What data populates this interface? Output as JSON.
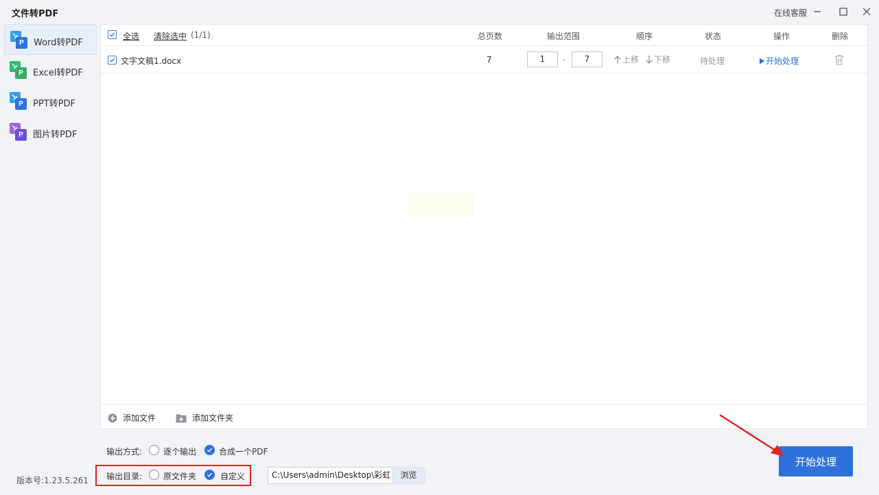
{
  "window": {
    "title": "文件转PDF",
    "service": "在线客服"
  },
  "sidebar": {
    "items": [
      {
        "label": "Word转PDF",
        "icon": "word-icon",
        "color": "#2e72d9",
        "back": "#35a0e8"
      },
      {
        "label": "Excel转PDF",
        "icon": "excel-icon",
        "color": "#3aab6a",
        "back": "#2fbe78"
      },
      {
        "label": "PPT转PDF",
        "icon": "ppt-icon",
        "color": "#2e72d9",
        "back": "#35a0e8"
      },
      {
        "label": "图片转PDF",
        "icon": "image-icon",
        "color": "#6b4fd8",
        "back": "#9a6ae0"
      }
    ]
  },
  "table": {
    "select_all": "全选",
    "clear_selection": "清除选中",
    "count": "(1/1)",
    "columns": {
      "pages": "总页数",
      "range": "输出范围",
      "order": "顺序",
      "status": "状态",
      "action": "操作",
      "delete": "删除"
    },
    "rows": [
      {
        "name": "文字文稿1.docx",
        "pages": "7",
        "range_from": "1",
        "range_sep": "-",
        "range_to": "7",
        "up": "上移",
        "down": "下移",
        "status": "待处理",
        "action": "开始处理"
      }
    ]
  },
  "footer": {
    "add_file": "添加文件",
    "add_folder": "添加文件夹"
  },
  "output": {
    "mode_label": "输出方式:",
    "mode_options": [
      "逐个输出",
      "合成一个PDF"
    ],
    "mode_selected": "合成一个PDF",
    "dir_label": "输出目录:",
    "dir_options": [
      "原文件夹",
      "自定义"
    ],
    "dir_selected": "自定义",
    "path": "C:\\Users\\admin\\Desktop\\彩虹",
    "browse": "浏览"
  },
  "version": "版本号:1.23.5.261",
  "start_button": "开始处理",
  "colors": {
    "accent": "#2e72d9",
    "highlight": "#e12121"
  }
}
